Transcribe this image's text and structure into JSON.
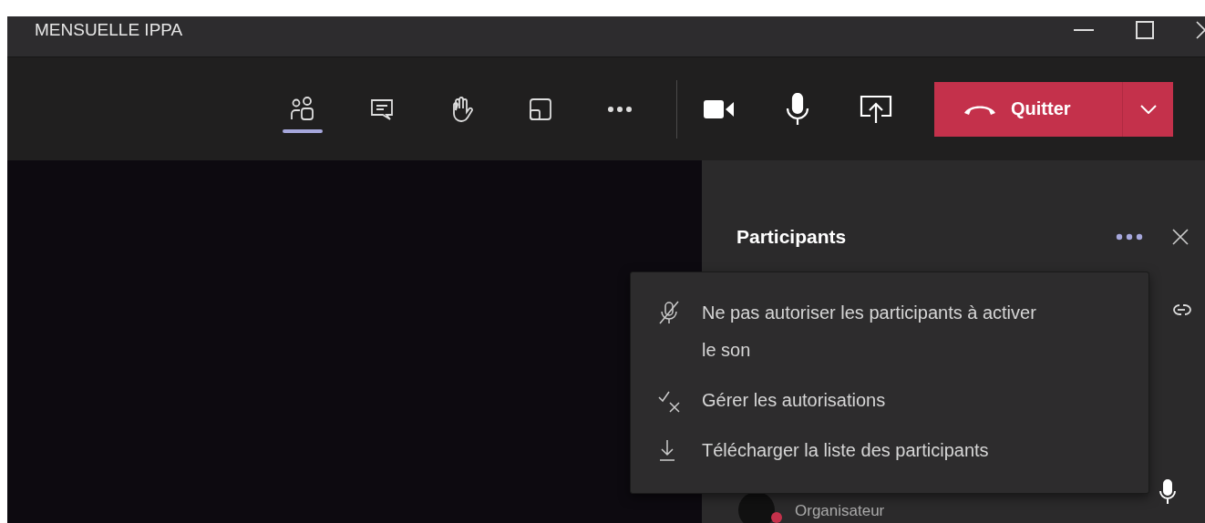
{
  "window": {
    "title": "MENSUELLE IPPA"
  },
  "toolbar": {
    "buttons": [
      {
        "kind": "people",
        "selected": true
      },
      {
        "kind": "chat",
        "selected": false
      },
      {
        "kind": "hand",
        "selected": false
      },
      {
        "kind": "rooms",
        "selected": false
      },
      {
        "kind": "more",
        "selected": false
      }
    ],
    "devices": [
      {
        "kind": "camera"
      },
      {
        "kind": "mic"
      },
      {
        "kind": "share"
      }
    ],
    "leave_button": {
      "label": "Quitter"
    }
  },
  "panel": {
    "title": "Participants",
    "participant": {
      "role": "Organisateur"
    }
  },
  "menu": {
    "items": [
      {
        "kind": "mute",
        "label": "Ne pas autoriser les participants à activer le son"
      },
      {
        "kind": "permissions",
        "label": "Gérer les autorisations"
      },
      {
        "kind": "download",
        "label": "Télécharger la liste des participants"
      }
    ]
  }
}
